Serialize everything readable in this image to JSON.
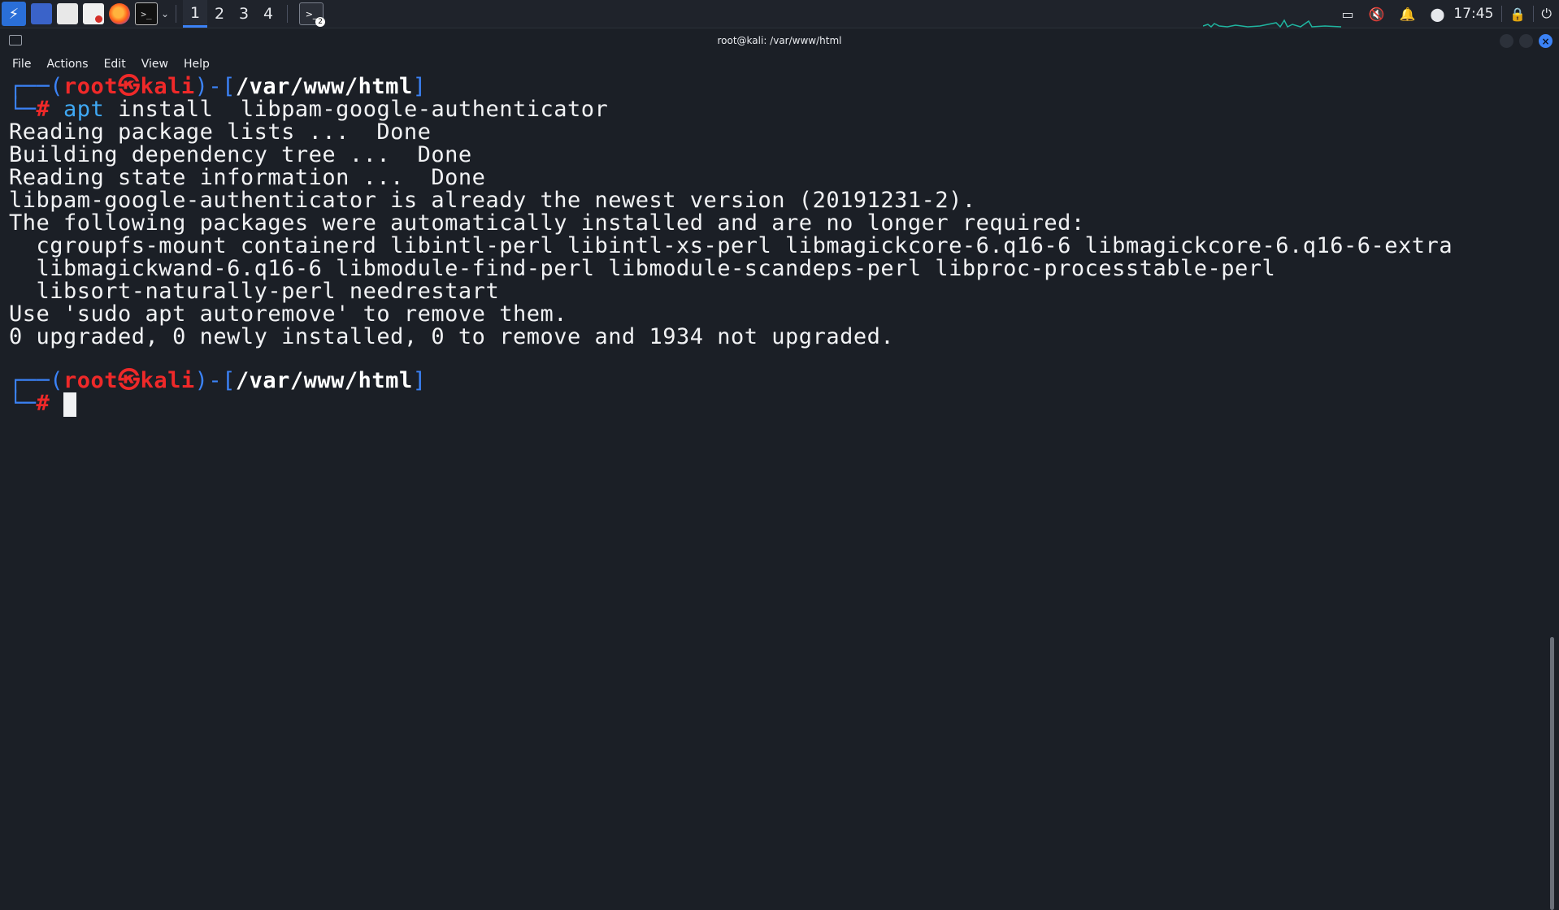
{
  "panel": {
    "workspaces": [
      "1",
      "2",
      "3",
      "4"
    ],
    "active_workspace": "1",
    "terminal_task_badge": "2",
    "clock": "17:45",
    "icons": [
      "kali-menu-icon",
      "show-desktop-icon",
      "file-manager-icon",
      "text-editor-icon",
      "firefox-icon",
      "terminal-icon",
      "screen-icon",
      "mute-icon",
      "bell-icon",
      "update-icon",
      "lock-icon",
      "power-icon"
    ]
  },
  "window": {
    "title": "root@kali: /var/www/html",
    "menu": [
      "File",
      "Actions",
      "Edit",
      "View",
      "Help"
    ]
  },
  "terminal": {
    "prompt1": {
      "user": "root",
      "host": "kali",
      "path": "/var/www/html",
      "symbol": "#"
    },
    "command": {
      "program": "apt",
      "args": "install  libpam-google-authenticator"
    },
    "output": [
      "Reading package lists ...  Done",
      "Building dependency tree ...  Done",
      "Reading state information ...  Done",
      "libpam-google-authenticator is already the newest version (20191231-2).",
      "The following packages were automatically installed and are no longer required:",
      "  cgroupfs-mount containerd libintl-perl libintl-xs-perl libmagickcore-6.q16-6 libmagickcore-6.q16-6-extra",
      "  libmagickwand-6.q16-6 libmodule-find-perl libmodule-scandeps-perl libproc-processtable-perl",
      "  libsort-naturally-perl needrestart",
      "Use 'sudo apt autoremove' to remove them.",
      "0 upgraded, 0 newly installed, 0 to remove and 1934 not upgraded."
    ],
    "prompt2": {
      "user": "root",
      "host": "kali",
      "path": "/var/www/html",
      "symbol": "#"
    }
  },
  "colors": {
    "background": "#1b1f26",
    "prompt_frame": "#3b82f6",
    "prompt_user": "#ef2929",
    "command": "#3fa9f5",
    "accent": "#3b82f6"
  }
}
